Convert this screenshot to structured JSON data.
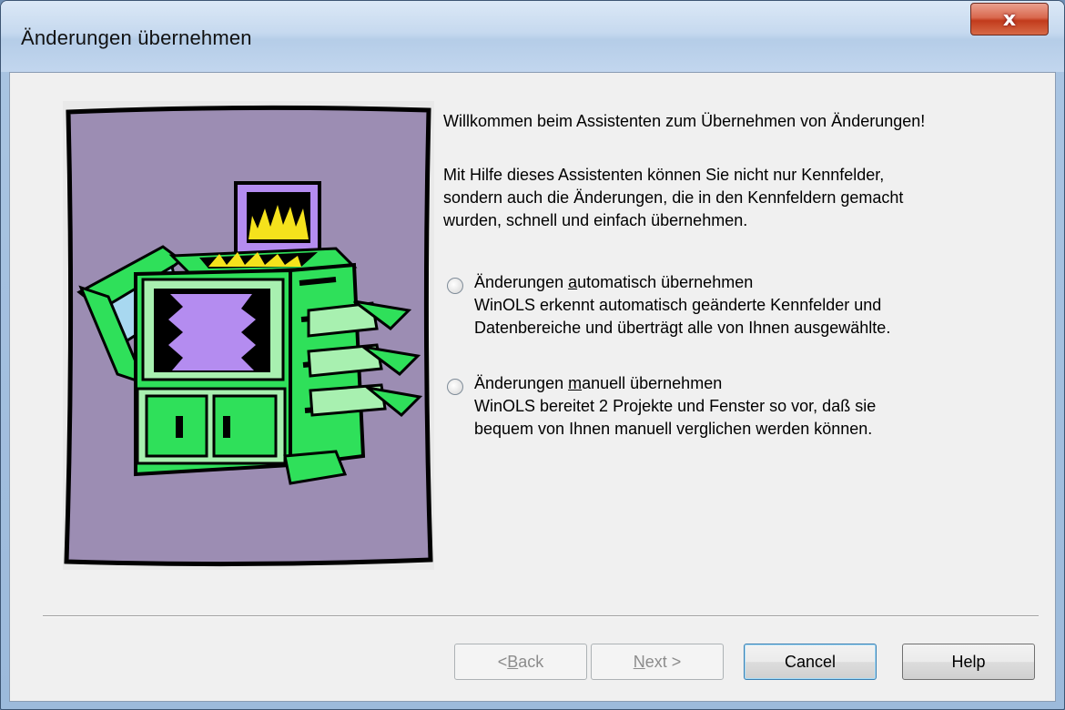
{
  "window": {
    "title": "Änderungen übernehmen",
    "close_label": "x"
  },
  "content": {
    "welcome": "Willkommen beim Assistenten zum Übernehmen von Änderungen!",
    "intro_lines": [
      "Mit Hilfe dieses Assistenten können Sie nicht nur Kennfelder,",
      "sondern auch die Änderungen, die in den Kennfeldern gemacht",
      "wurden, schnell und einfach übernehmen."
    ],
    "options": [
      {
        "label_before": "Änderungen ",
        "label_mnemonic": "a",
        "label_after": "utomatisch übernehmen",
        "description_lines": [
          "WinOLS erkennt automatisch geänderte Kennfelder und",
          "Datenbereiche und überträgt alle von Ihnen ausgewählte."
        ],
        "selected": false
      },
      {
        "label_before": "Änderungen ",
        "label_mnemonic": "m",
        "label_after": "anuell übernehmen",
        "description_lines": [
          "WinOLS bereitet 2 Projekte und Fenster so vor, daß sie",
          "bequem von Ihnen manuell verglichen werden können."
        ],
        "selected": false
      }
    ]
  },
  "buttons": {
    "back_prefix": "< ",
    "back_mnemonic": "B",
    "back_rest": "ack",
    "next_mnemonic": "N",
    "next_rest": "ext >",
    "cancel": "Cancel",
    "help": "Help"
  },
  "colors": {
    "illustration_background": "#9c8db3",
    "printer_green": "#2fe05a",
    "printer_light_green": "#a8f0b0",
    "paper_purple": "#b48cf0",
    "flame_yellow": "#f5e21c",
    "close_button": "#c23b1c"
  },
  "icons": {
    "illustration": "printer-copier-illustration",
    "close": "close-icon"
  }
}
